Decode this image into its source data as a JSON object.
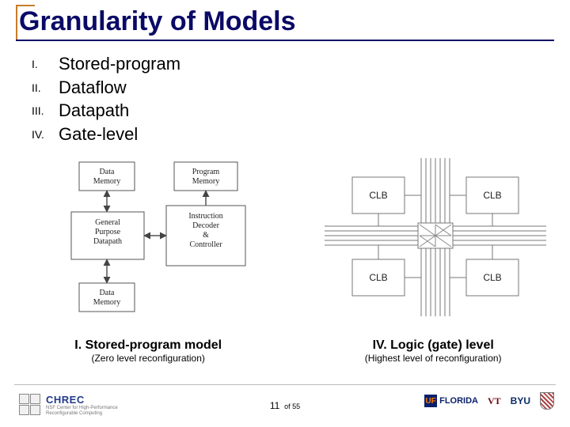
{
  "title": "Granularity of Models",
  "list": {
    "items": [
      {
        "rn": "I.",
        "label": "Stored-program"
      },
      {
        "rn": "II.",
        "label": "Dataflow"
      },
      {
        "rn": "III.",
        "label": "Datapath"
      },
      {
        "rn": "IV.",
        "label": "Gate-level"
      }
    ]
  },
  "figures": {
    "left": {
      "boxes": {
        "data_memory_top": "Data\nMemory",
        "program_memory": "Program\nMemory",
        "datapath": "General\nPurpose\nDatapath",
        "controller": "Instruction\nDecoder\n&\nController",
        "data_memory_bottom": "Data\nMemory"
      },
      "caption_title": "I.  Stored-program model",
      "caption_sub": "(Zero level reconfiguration)"
    },
    "right": {
      "box_label": "CLB",
      "caption_title": "IV.  Logic (gate) level",
      "caption_sub": "(Highest level of reconfiguration)"
    }
  },
  "footer": {
    "page_current": "11",
    "page_sep": "of",
    "page_total": "55",
    "chrec": {
      "acronym": "CHREC",
      "line1": "NSF Center for High-Performance",
      "line2": "Reconfigurable Computing"
    },
    "uf": {
      "badge": "UF",
      "word": "FLORIDA"
    },
    "vt": "VT",
    "byu": "BYU"
  }
}
